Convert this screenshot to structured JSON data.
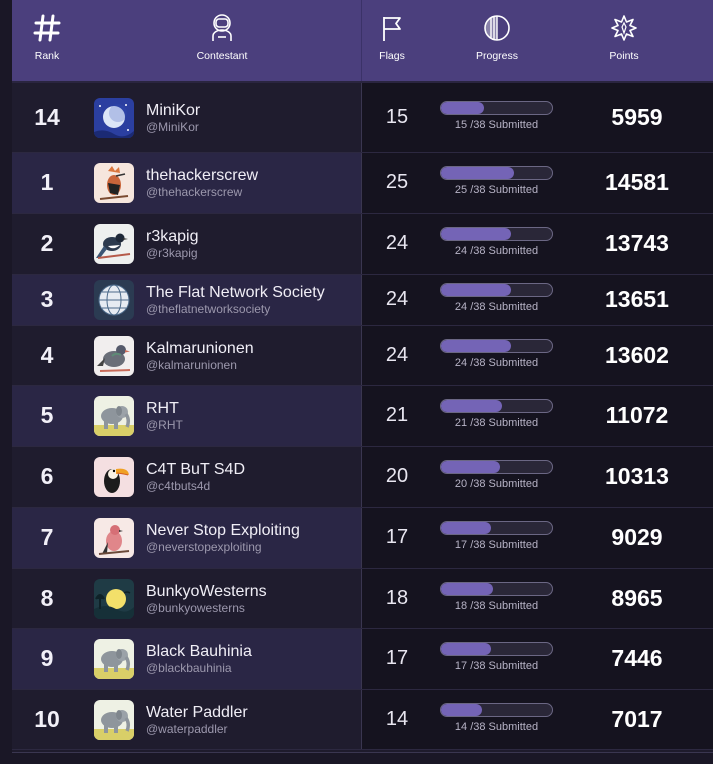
{
  "header": {
    "rank_label": "Rank",
    "contestant_label": "Contestant",
    "flags_label": "Flags",
    "progress_label": "Progress",
    "points_label": "Points"
  },
  "colors": {
    "header_bg": "#4b3f7d",
    "progress_fill": "#7464b6",
    "row_alt": "#2a2645"
  },
  "total_flags": 38,
  "rows": [
    {
      "rank": "14",
      "name": "MiniKor",
      "handle": "@MiniKor",
      "flags": "15",
      "progress_text": "15 /38 Submitted",
      "progress": 0.39,
      "points": "5959",
      "avatar": "moon-night-avatar",
      "alt": false
    },
    {
      "rank": "1",
      "name": "thehackerscrew",
      "handle": "@thehackerscrew",
      "flags": "25",
      "progress_text": "25 /38 Submitted",
      "progress": 0.66,
      "points": "14581",
      "avatar": "hoopoe-bird-avatar",
      "alt": true
    },
    {
      "rank": "2",
      "name": "r3kapig",
      "handle": "@r3kapig",
      "flags": "24",
      "progress_text": "24 /38 Submitted",
      "progress": 0.63,
      "points": "13743",
      "avatar": "magpie-bird-avatar",
      "alt": false
    },
    {
      "rank": "3",
      "name": "The Flat Network Society",
      "handle": "@theflatnetworksociety",
      "flags": "24",
      "progress_text": "24 /38 Submitted",
      "progress": 0.63,
      "points": "13651",
      "avatar": "globe-avatar",
      "alt": true
    },
    {
      "rank": "4",
      "name": "Kalmarunionen",
      "handle": "@kalmarunionen",
      "flags": "24",
      "progress_text": "24 /38 Submitted",
      "progress": 0.63,
      "points": "13602",
      "avatar": "pigeon-avatar",
      "alt": false
    },
    {
      "rank": "5",
      "name": "RHT",
      "handle": "@RHT",
      "flags": "21",
      "progress_text": "21 /38 Submitted",
      "progress": 0.55,
      "points": "11072",
      "avatar": "elephant-avatar",
      "alt": true
    },
    {
      "rank": "6",
      "name": "C4T BuT S4D",
      "handle": "@c4tbuts4d",
      "flags": "20",
      "progress_text": "20 /38 Submitted",
      "progress": 0.53,
      "points": "10313",
      "avatar": "toucan-avatar",
      "alt": false
    },
    {
      "rank": "7",
      "name": "Never Stop Exploiting",
      "handle": "@neverstopexploiting",
      "flags": "17",
      "progress_text": "17 /38 Submitted",
      "progress": 0.45,
      "points": "9029",
      "avatar": "pink-bird-avatar",
      "alt": true
    },
    {
      "rank": "8",
      "name": "BunkyoWesterns",
      "handle": "@bunkyowesterns",
      "flags": "18",
      "progress_text": "18 /38 Submitted",
      "progress": 0.47,
      "points": "8965",
      "avatar": "sunset-tree-avatar",
      "alt": false
    },
    {
      "rank": "9",
      "name": "Black Bauhinia",
      "handle": "@blackbauhinia",
      "flags": "17",
      "progress_text": "17 /38 Submitted",
      "progress": 0.45,
      "points": "7446",
      "avatar": "elephant-avatar",
      "alt": true
    },
    {
      "rank": "10",
      "name": "Water Paddler",
      "handle": "@waterpaddler",
      "flags": "14",
      "progress_text": "14 /38 Submitted",
      "progress": 0.37,
      "points": "7017",
      "avatar": "elephant-avatar",
      "alt": false
    }
  ]
}
